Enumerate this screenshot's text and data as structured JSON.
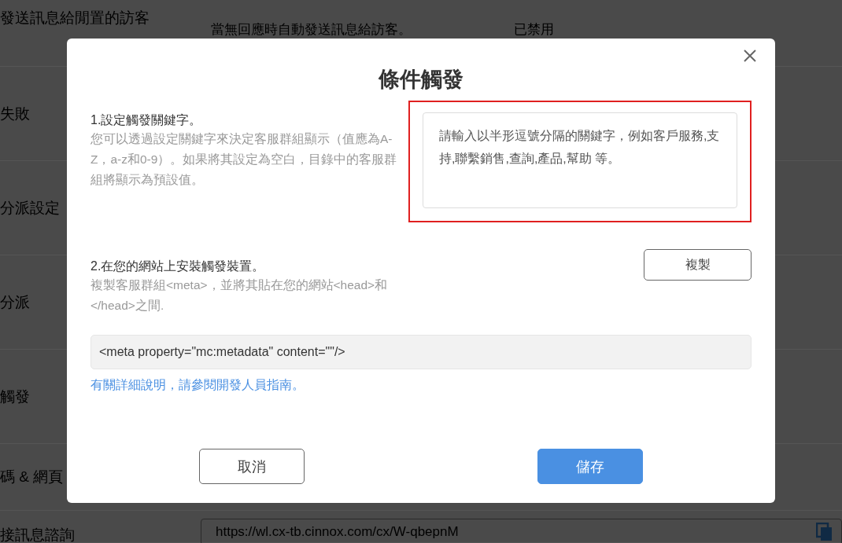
{
  "background_page": {
    "rows": [
      {
        "label": "發送訊息給閒置的訪客",
        "description": "當無回應時自動發送訊息給訪客。",
        "status": "已禁用"
      },
      {
        "label": "失敗"
      },
      {
        "label": "分派設定"
      },
      {
        "label": "分派"
      },
      {
        "label": "觸發"
      },
      {
        "label": "碼 & 網頁"
      },
      {
        "label": "接訊息諮詢",
        "url": "https://wl.cx-tb.cinnox.com/cx/W-qbepnM"
      }
    ]
  },
  "dialog": {
    "title": "條件觸發",
    "step_1": {
      "heading": "1.設定觸發關鍵字。",
      "description": "您可以透過設定關鍵字來決定客服群組顯示（值應為A-Z，a-z和0-9）。如果將其設定為空白，目錄中的客服群組將顯示為預設值。",
      "keywords_field": {
        "placeholder": "請輸入以半形逗號分隔的關鍵字，例如客戶服務,支持,聯繫銷售,查詢,產品,幫助 等。",
        "highlighted": true
      }
    },
    "step_2": {
      "heading": "2.在您的網站上安裝觸發裝置。",
      "description": "複製客服群組<meta>，並將其貼在您的網站<head>和</head>之間.",
      "copy_button": "複製",
      "code": "<meta property=\"mc:metadata\" content=\"\"/>",
      "help_link": "有關詳細說明，請參閱開發人員指南。"
    },
    "buttons": [
      {
        "label": "取消",
        "kind": "secondary"
      },
      {
        "label": "儲存",
        "kind": "primary"
      }
    ]
  }
}
